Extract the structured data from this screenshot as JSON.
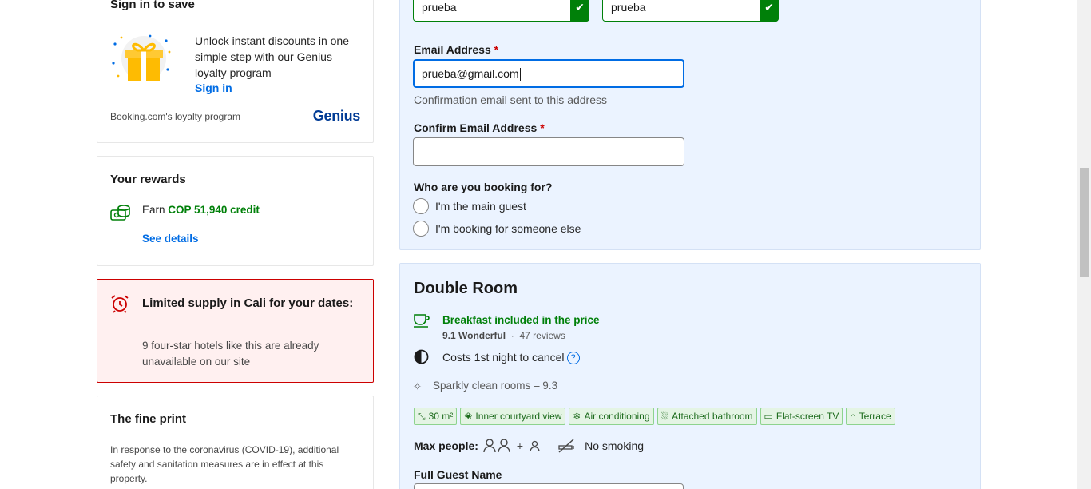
{
  "signin": {
    "title": "Sign in to save",
    "text": "Unlock instant discounts in one simple step with our Genius loyalty program",
    "link": "Sign in",
    "caption": "Booking.com's loyalty program",
    "brand": "Genius"
  },
  "rewards": {
    "title": "Your rewards",
    "earn_prefix": "Earn",
    "amount": "COP 51,940 credit",
    "link": "See details"
  },
  "supply": {
    "title": "Limited supply in Cali for your dates:",
    "text": "9 four-star hotels like this are already unavailable on our site"
  },
  "fine_print": {
    "title": "The fine print",
    "text": "In response to the coronavirus (COVID-19), additional safety and sanitation measures are in effect at this property."
  },
  "form": {
    "first_name_value": "prueba",
    "last_name_value": "prueba",
    "email_label": "Email Address",
    "email_value": "prueba@gmail.com",
    "email_helper": "Confirmation email sent to this address",
    "confirm_email_label": "Confirm Email Address",
    "confirm_email_value": "",
    "required_mark": "*",
    "booking_for_label": "Who are you booking for?",
    "booking_for_options": [
      "I'm the main guest",
      "I'm booking for someone else"
    ]
  },
  "room": {
    "title": "Double Room",
    "breakfast": "Breakfast included in the price",
    "rating_score": "9.1 Wonderful",
    "rating_separator": "·",
    "reviews": "47 reviews",
    "cancel_text": "Costs 1st night to cancel",
    "help_glyph": "?",
    "clean_text": "Sparkly clean rooms – 9.3",
    "facilities": [
      {
        "icon": "size-icon",
        "label": "30 m²"
      },
      {
        "icon": "courtyard-icon",
        "label": "Inner courtyard view"
      },
      {
        "icon": "snowflake-icon",
        "label": "Air conditioning"
      },
      {
        "icon": "bathroom-icon",
        "label": "Attached bathroom"
      },
      {
        "icon": "tv-icon",
        "label": "Flat-screen TV"
      },
      {
        "icon": "terrace-icon",
        "label": "Terrace"
      }
    ],
    "max_people_label": "Max people:",
    "plus": "+",
    "no_smoking": "No smoking",
    "guest_name_label": "Full Guest Name"
  },
  "colors": {
    "accent": "#006ce4",
    "success": "#008009",
    "danger": "#cc0000",
    "panel": "#ebf3ff"
  }
}
